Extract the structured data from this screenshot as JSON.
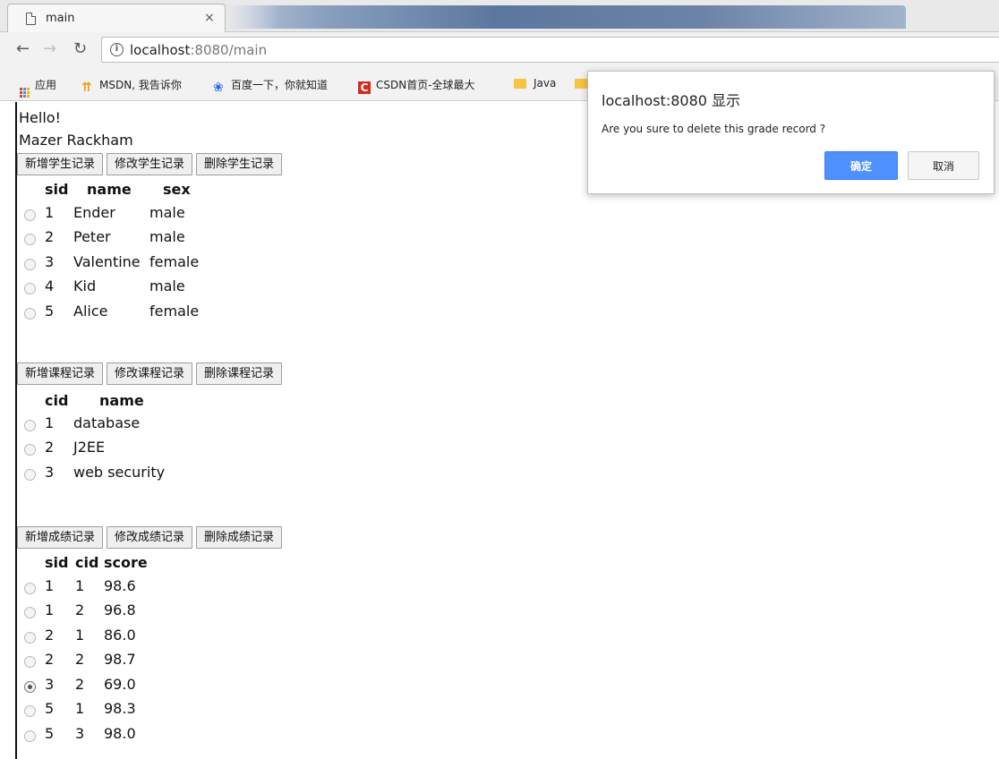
{
  "browser": {
    "tab_title": "main",
    "tab_close": "×",
    "url_host": "localhost",
    "url_path": ":8080/main",
    "bookmarks": [
      {
        "label": "应用",
        "icon": "apps-grid-icon"
      },
      {
        "label": "MSDN, 我告诉你",
        "icon": "msdn-icon"
      },
      {
        "label": "百度一下，你就知道",
        "icon": "baidu-paw-icon"
      },
      {
        "label": "CSDN首页-全球最大",
        "icon": "csdn-icon"
      },
      {
        "label": "Java",
        "icon": "folder-icon"
      }
    ]
  },
  "page": {
    "greeting": "Hello!",
    "user": "Mazer Rackham"
  },
  "students": {
    "buttons": [
      "新增学生记录",
      "修改学生记录",
      "删除学生记录"
    ],
    "headers": [
      "sid",
      "name",
      "sex"
    ],
    "rows": [
      {
        "sid": "1",
        "name": "Ender",
        "sex": "male"
      },
      {
        "sid": "2",
        "name": "Peter",
        "sex": "male"
      },
      {
        "sid": "3",
        "name": "Valentine",
        "sex": "female"
      },
      {
        "sid": "4",
        "name": "Kid",
        "sex": "male"
      },
      {
        "sid": "5",
        "name": "Alice",
        "sex": "female"
      }
    ]
  },
  "courses": {
    "buttons": [
      "新增课程记录",
      "修改课程记录",
      "删除课程记录"
    ],
    "headers": [
      "cid",
      "name"
    ],
    "rows": [
      {
        "cid": "1",
        "name": "database"
      },
      {
        "cid": "2",
        "name": "J2EE"
      },
      {
        "cid": "3",
        "name": "web security"
      }
    ]
  },
  "grades": {
    "buttons": [
      "新增成绩记录",
      "修改成绩记录",
      "删除成绩记录"
    ],
    "headers": [
      "sid",
      "cid",
      "score"
    ],
    "rows": [
      {
        "sid": "1",
        "cid": "1",
        "score": "98.6",
        "checked": false
      },
      {
        "sid": "1",
        "cid": "2",
        "score": "96.8",
        "checked": false
      },
      {
        "sid": "2",
        "cid": "1",
        "score": "86.0",
        "checked": false
      },
      {
        "sid": "2",
        "cid": "2",
        "score": "98.7",
        "checked": false
      },
      {
        "sid": "3",
        "cid": "2",
        "score": "69.0",
        "checked": true
      },
      {
        "sid": "5",
        "cid": "1",
        "score": "98.3",
        "checked": false
      },
      {
        "sid": "5",
        "cid": "3",
        "score": "98.0",
        "checked": false
      }
    ]
  },
  "dialog": {
    "title": "localhost:8080 显示",
    "message": "Are you sure to delete this grade record ?",
    "ok_label": "确定",
    "cancel_label": "取消"
  },
  "colors": {
    "accent": "#4d90fe"
  }
}
